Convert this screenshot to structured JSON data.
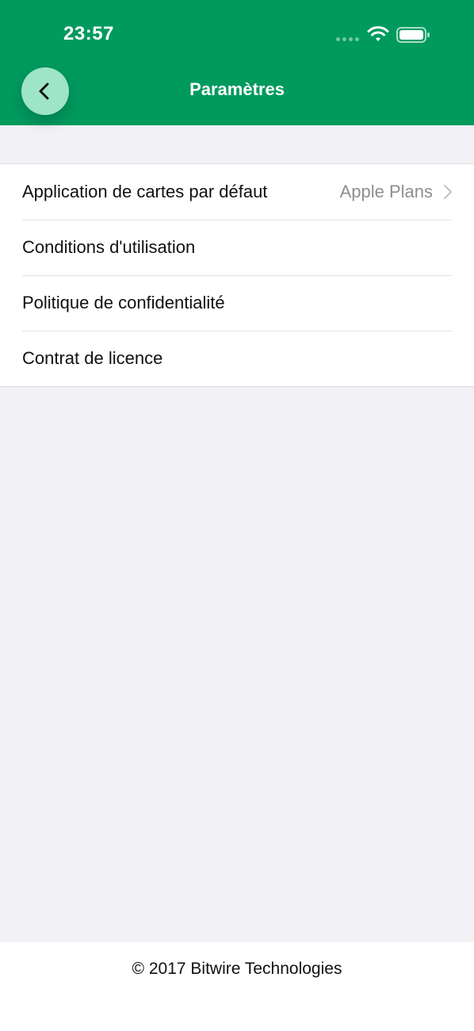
{
  "status_bar": {
    "time": "23:57",
    "icons": [
      "signal-dots-icon",
      "wifi-icon",
      "battery-icon"
    ]
  },
  "header": {
    "title": "Paramètres",
    "back_icon": "chevron-left-icon"
  },
  "settings": {
    "items": [
      {
        "label": "Application de cartes par défaut",
        "value": "Apple Plans",
        "icon": "chevron-right-icon"
      },
      {
        "label": "Conditions d'utilisation"
      },
      {
        "label": "Politique de confidentialité"
      },
      {
        "label": "Contrat de licence"
      }
    ]
  },
  "footer": {
    "copyright": "© 2017 Bitwire Technologies"
  },
  "colors": {
    "header_green": "#009a5d",
    "back_button_bg": "#9ee4c6",
    "background": "#f1f1f6",
    "secondary_text": "#8e8e93"
  }
}
